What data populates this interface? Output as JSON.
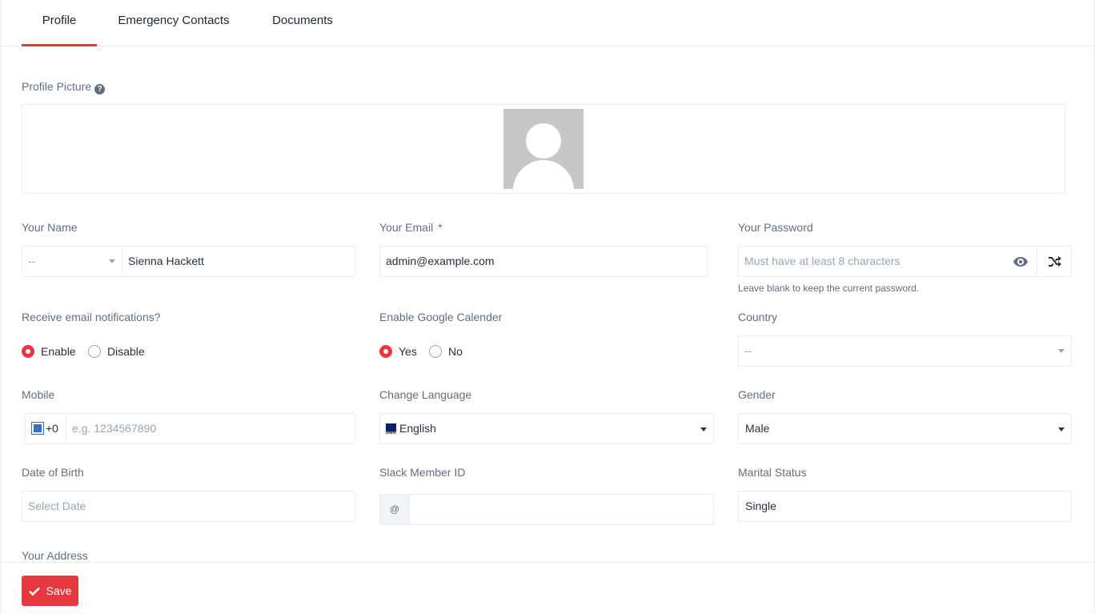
{
  "tabs": [
    {
      "label": "Profile",
      "active": true
    },
    {
      "label": "Emergency Contacts",
      "active": false
    },
    {
      "label": "Documents",
      "active": false
    }
  ],
  "profile_picture": {
    "label": "Profile Picture",
    "help_icon": "question-circle-icon"
  },
  "name": {
    "label": "Your Name",
    "salutation": "--",
    "value": "Sienna Hackett"
  },
  "email": {
    "label": "Your Email",
    "required_mark": "*",
    "value": "admin@example.com"
  },
  "password": {
    "label": "Your Password",
    "placeholder": "Must have at least 8 characters",
    "help": "Leave blank to keep the current password."
  },
  "email_notifications": {
    "label": "Receive email notifications?",
    "options": [
      {
        "label": "Enable",
        "checked": true
      },
      {
        "label": "Disable",
        "checked": false
      }
    ]
  },
  "google_calendar": {
    "label": "Enable Google Calender",
    "options": [
      {
        "label": "Yes",
        "checked": true
      },
      {
        "label": "No",
        "checked": false
      }
    ]
  },
  "country": {
    "label": "Country",
    "value": "--"
  },
  "mobile": {
    "label": "Mobile",
    "code": "+0",
    "placeholder": "e.g. 1234567890"
  },
  "language": {
    "label": "Change Language",
    "value": "English"
  },
  "gender": {
    "label": "Gender",
    "value": "Male"
  },
  "dob": {
    "label": "Date of Birth",
    "placeholder": "Select Date"
  },
  "slack": {
    "label": "Slack Member ID",
    "prefix": "@",
    "value": ""
  },
  "marital": {
    "label": "Marital Status",
    "value": "Single"
  },
  "address": {
    "label": "Your Address"
  },
  "save": {
    "label": "Save"
  },
  "colors": {
    "accent": "#e8383f",
    "label": "#616e80",
    "border": "#e8eef3"
  }
}
